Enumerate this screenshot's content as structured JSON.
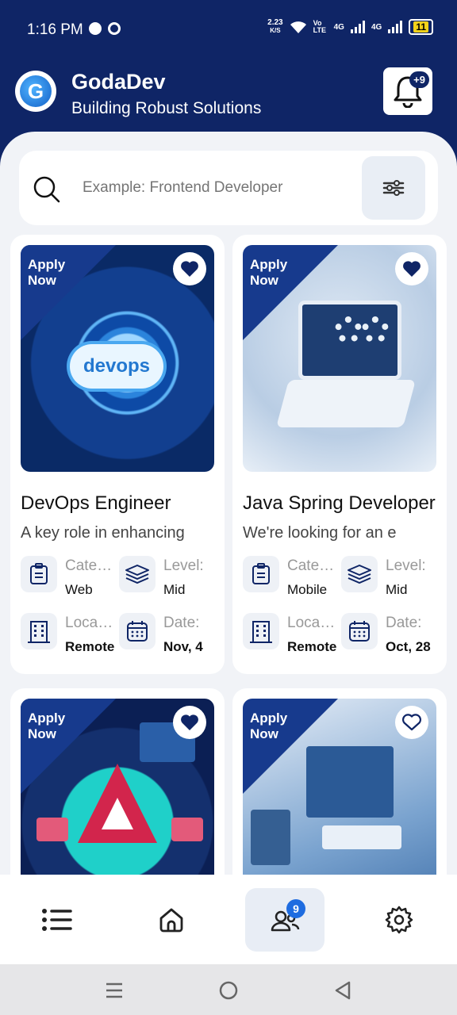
{
  "status": {
    "time": "1:16 PM",
    "speed_value": "2.23",
    "speed_unit": "K/S",
    "volte": "Vo LTE",
    "net1": "4G",
    "net2": "4G",
    "battery": "11"
  },
  "header": {
    "logo_letter": "G",
    "title": "GodaDev",
    "subtitle": "Building Robust Solutions",
    "notification_badge": "+9"
  },
  "search": {
    "placeholder": "Example: Frontend Developer"
  },
  "cards": [
    {
      "badge": "Apply Now",
      "image_text": "devops",
      "favorited": true,
      "title": "DevOps Engineer",
      "description": "A key role in enhancing",
      "category_label": "Category",
      "category_value": "Web",
      "level_label": "Level:",
      "level_value": "Mid",
      "location_label": "Location",
      "location_value": "Remote",
      "date_label": "Date:",
      "date_value": "Nov, 4"
    },
    {
      "badge": "Apply Now",
      "favorited": true,
      "title": "Java Spring Developer",
      "description": "We're looking for an e",
      "category_label": "Category",
      "category_value": "Mobile",
      "level_label": "Level:",
      "level_value": "Mid",
      "location_label": "Location",
      "location_value": "Remote",
      "date_label": "Date:",
      "date_value": "Oct, 28"
    },
    {
      "badge": "Apply Now",
      "favorited": true
    },
    {
      "badge": "Apply Now",
      "favorited": false
    }
  ],
  "bottom_nav": {
    "items": [
      "list-icon",
      "home-icon",
      "users-icon",
      "settings-icon"
    ],
    "active": "users-icon",
    "users_badge": "9"
  },
  "colors": {
    "brand_navy": "#0f2566",
    "badge_blue": "#1e6ce0",
    "sheet_bg": "#f1f3f7"
  }
}
